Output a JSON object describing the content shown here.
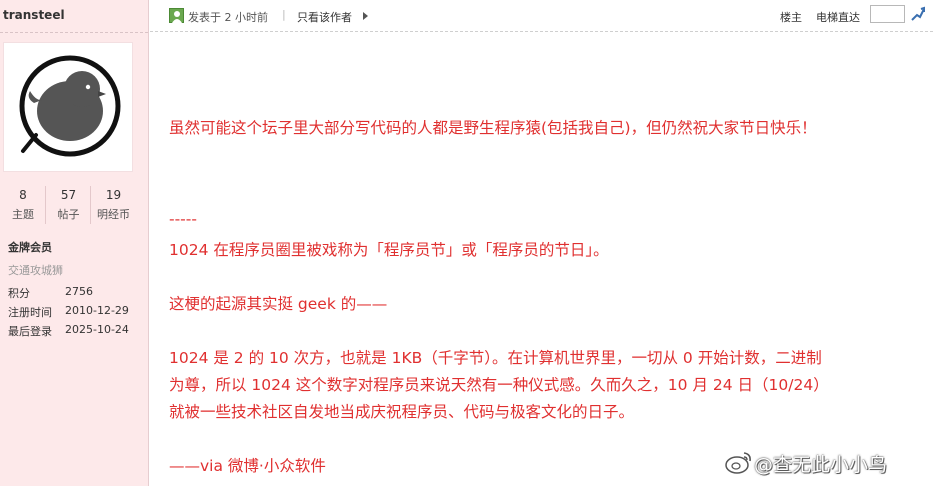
{
  "author": {
    "username": "transteel",
    "stats": [
      {
        "value": "8",
        "label": "主题"
      },
      {
        "value": "57",
        "label": "帖子"
      },
      {
        "value": "19",
        "label": "明经币"
      }
    ],
    "group": "金牌会员",
    "custom_title": "交通攻城狮",
    "info": [
      {
        "key": "积分",
        "value": "2756"
      },
      {
        "key": "注册时间",
        "value": "2010-12-29"
      },
      {
        "key": "最后登录",
        "value": "2025-10-24"
      }
    ]
  },
  "header": {
    "posted": "发表于 2 小时前",
    "divider": "|",
    "author_only": "只看该作者",
    "floor": "楼主",
    "jump": "电梯直达",
    "jump_value": ""
  },
  "post": {
    "lines": [
      "虽然可能这个坛子里大部分写代码的人都是野生程序猿(包括我自己)，但仍然祝大家节日快乐！",
      "-----",
      "1024 在程序员圈里被戏称为「程序员节」或「程序员的节日」。",
      "这梗的起源其实挺 geek 的——",
      "1024 是 2 的 10 次方，也就是 1KB（千字节）。在计算机世界里，一切从 0 开始计数，二进制",
      "为尊，所以 1024 这个数字对程序员来说天然有一种仪式感。久而久之，10 月 24 日（10/24）",
      "就被一些技术社区自发地当成庆祝程序员、代码与极客文化的日子。",
      "——via 微博·小众软件"
    ]
  },
  "watermark": "@查无此小小鸟",
  "colors": {
    "sidebar_bg": "#fde9ea",
    "post_text": "#e03030"
  }
}
